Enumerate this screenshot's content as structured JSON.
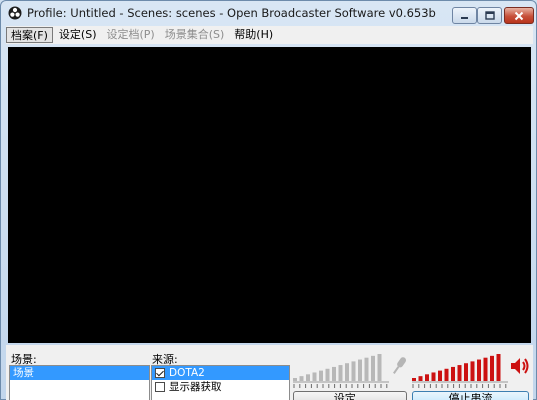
{
  "window": {
    "title": "Profile: Untitled - Scenes: scenes - Open Broadcaster Software v0.653b"
  },
  "menu": [
    {
      "label": "档案(F)",
      "state": "active"
    },
    {
      "label": "设定(S)",
      "state": "normal"
    },
    {
      "label": "设定档(P)",
      "state": "disabled"
    },
    {
      "label": "场景集合(S)",
      "state": "disabled"
    },
    {
      "label": "帮助(H)",
      "state": "normal"
    }
  ],
  "scenes": {
    "label": "场景:",
    "items": [
      {
        "label": "场景",
        "selected": true
      }
    ]
  },
  "sources": {
    "label": "来源:",
    "items": [
      {
        "label": "DOTA2",
        "checked": true,
        "selected": true
      },
      {
        "label": "显示器获取",
        "checked": false,
        "selected": false
      }
    ]
  },
  "audio": {
    "mic_icon": "microphone-icon",
    "speaker_icon": "speaker-icon",
    "mic_level": 0.0,
    "desktop_level": 1.0,
    "colors": {
      "active": "#cc1111",
      "inactive": "#b8b8b8"
    }
  },
  "buttons": {
    "settings": "设定...",
    "stream": "停止串流"
  }
}
